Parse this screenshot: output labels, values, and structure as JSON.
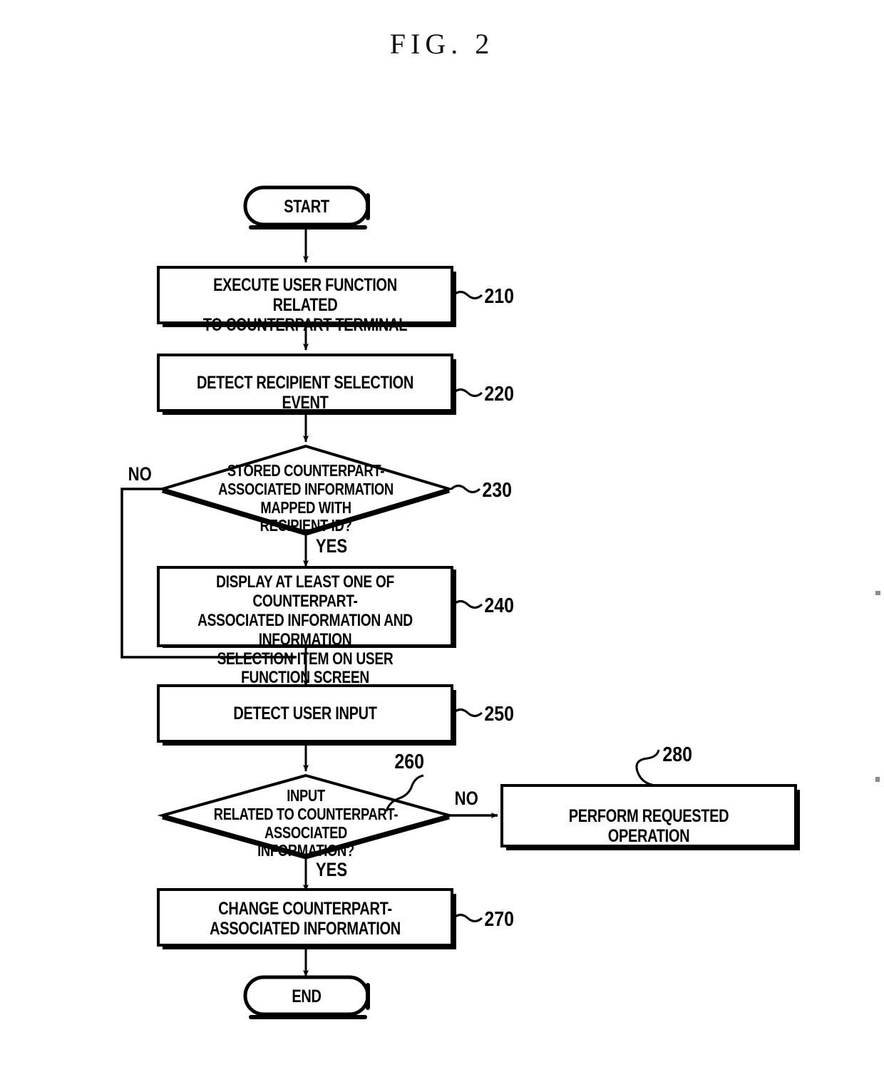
{
  "figure": {
    "title": "FIG. 2",
    "type": "patent-flowchart"
  },
  "chart_data": {
    "type": "diagram",
    "title": "FIG. 2",
    "nodes": [
      {
        "id": "start",
        "shape": "terminator",
        "text": "START",
        "ref": ""
      },
      {
        "id": "n210",
        "shape": "process",
        "text": "EXECUTE USER FUNCTION RELATED\nTO COUNTERPART TERMINAL",
        "ref": "210"
      },
      {
        "id": "n220",
        "shape": "process",
        "text": "DETECT RECIPIENT SELECTION EVENT",
        "ref": "220"
      },
      {
        "id": "n230",
        "shape": "decision",
        "text": "STORED COUNTERPART-\nASSOCIATED INFORMATION MAPPED WITH\nRECIPIENT ID?",
        "ref": "230"
      },
      {
        "id": "n240",
        "shape": "process",
        "text": "DISPLAY AT LEAST ONE OF COUNTERPART-\nASSOCIATED INFORMATION AND INFORMATION\nSELECTION ITEM ON USER FUNCTION SCREEN",
        "ref": "240"
      },
      {
        "id": "n250",
        "shape": "process",
        "text": "DETECT USER INPUT",
        "ref": "250"
      },
      {
        "id": "n260",
        "shape": "decision",
        "text": "INPUT\nRELATED TO COUNTERPART-ASSOCIATED\nINFORMATION?",
        "ref": "260"
      },
      {
        "id": "n270",
        "shape": "process",
        "text": "CHANGE COUNTERPART-\nASSOCIATED INFORMATION",
        "ref": "270"
      },
      {
        "id": "n280",
        "shape": "process",
        "text": "PERFORM REQUESTED OPERATION",
        "ref": "280"
      },
      {
        "id": "end",
        "shape": "terminator",
        "text": "END",
        "ref": ""
      }
    ],
    "edges": [
      {
        "from": "start",
        "to": "n210",
        "label": ""
      },
      {
        "from": "n210",
        "to": "n220",
        "label": ""
      },
      {
        "from": "n220",
        "to": "n230",
        "label": ""
      },
      {
        "from": "n230",
        "to": "n240",
        "label": "YES"
      },
      {
        "from": "n230",
        "to": "n250",
        "label": "NO"
      },
      {
        "from": "n240",
        "to": "n250",
        "label": ""
      },
      {
        "from": "n250",
        "to": "n260",
        "label": ""
      },
      {
        "from": "n260",
        "to": "n270",
        "label": "YES"
      },
      {
        "from": "n260",
        "to": "n280",
        "label": "NO"
      },
      {
        "from": "n270",
        "to": "end",
        "label": ""
      }
    ]
  },
  "nodes": {
    "start": {
      "text": "START"
    },
    "n210": {
      "text": "EXECUTE USER FUNCTION RELATED\nTO COUNTERPART TERMINAL",
      "ref": "210"
    },
    "n220": {
      "text": "DETECT RECIPIENT SELECTION EVENT",
      "ref": "220"
    },
    "n230": {
      "text": "STORED COUNTERPART-\nASSOCIATED INFORMATION MAPPED WITH\nRECIPIENT ID?",
      "ref": "230"
    },
    "n240": {
      "text": "DISPLAY AT LEAST ONE OF COUNTERPART-\nASSOCIATED INFORMATION AND INFORMATION\nSELECTION ITEM ON USER FUNCTION SCREEN",
      "ref": "240"
    },
    "n250": {
      "text": "DETECT USER INPUT",
      "ref": "250"
    },
    "n260": {
      "text": "INPUT\nRELATED TO COUNTERPART-ASSOCIATED\nINFORMATION?",
      "ref": "260"
    },
    "n270": {
      "text": "CHANGE COUNTERPART-\nASSOCIATED INFORMATION",
      "ref": "270"
    },
    "n280": {
      "text": "PERFORM REQUESTED OPERATION",
      "ref": "280"
    },
    "end": {
      "text": "END"
    }
  },
  "branch_labels": {
    "no_230": "NO",
    "yes_230": "YES",
    "no_260": "NO",
    "yes_260": "YES"
  },
  "colors": {
    "ink": "#000000",
    "paper": "#ffffff"
  }
}
